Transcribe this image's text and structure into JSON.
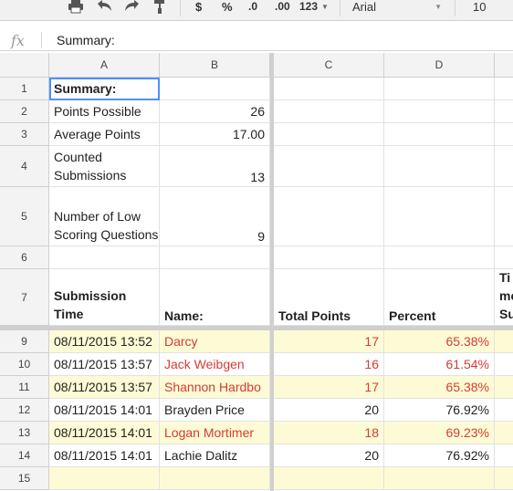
{
  "toolbar": {
    "currency": "$",
    "percent": "%",
    "decrease_decimals": ".0",
    "increase_decimals": ".00",
    "more_formats": "123",
    "font": "Arial",
    "font_size": "10"
  },
  "formula_bar": {
    "fx": "fx",
    "value": "Summary:"
  },
  "columns": [
    "A",
    "B",
    "C",
    "D"
  ],
  "rows": {
    "r1": {
      "num": "1",
      "a": "Summary:"
    },
    "r2": {
      "num": "2",
      "a": "Points Possible",
      "b": "26"
    },
    "r3": {
      "num": "3",
      "a": "Average Points",
      "b": "17.00"
    },
    "r4": {
      "num": "4",
      "a": "Counted Submissions",
      "b": "13"
    },
    "r5": {
      "num": "5",
      "a": "Number of Low Scoring Questions",
      "b": "9"
    },
    "r6": {
      "num": "6"
    },
    "r7": {
      "num": "7",
      "a": "Submission Time",
      "b": "Name:",
      "c": "Total Points",
      "d": "Percent",
      "e": "Time Su"
    },
    "r9": {
      "num": "9",
      "a": "08/11/2015 13:52",
      "b": "Darcy",
      "c": "17",
      "d": "65.38%"
    },
    "r10": {
      "num": "10",
      "a": "08/11/2015 13:57",
      "b": "Jack Weibgen",
      "c": "16",
      "d": "61.54%"
    },
    "r11": {
      "num": "11",
      "a": "08/11/2015 13:57",
      "b": "Shannon Hardbo",
      "c": "17",
      "d": "65.38%"
    },
    "r12": {
      "num": "12",
      "a": "08/11/2015 14:01",
      "b": "Brayden Price",
      "c": "20",
      "d": "76.92%"
    },
    "r13": {
      "num": "13",
      "a": "08/11/2015 14:01",
      "b": "Logan Mortimer",
      "c": "18",
      "d": "69.23%"
    },
    "r14": {
      "num": "14",
      "a": "08/11/2015 14:01",
      "b": "Lachie Dalitz",
      "c": "20",
      "d": "76.92%"
    },
    "r15": {
      "num": "15"
    }
  },
  "colors": {
    "highlight": "#fdfbd5",
    "low_score_text": "#d53b34",
    "selection": "#4d90fe"
  }
}
